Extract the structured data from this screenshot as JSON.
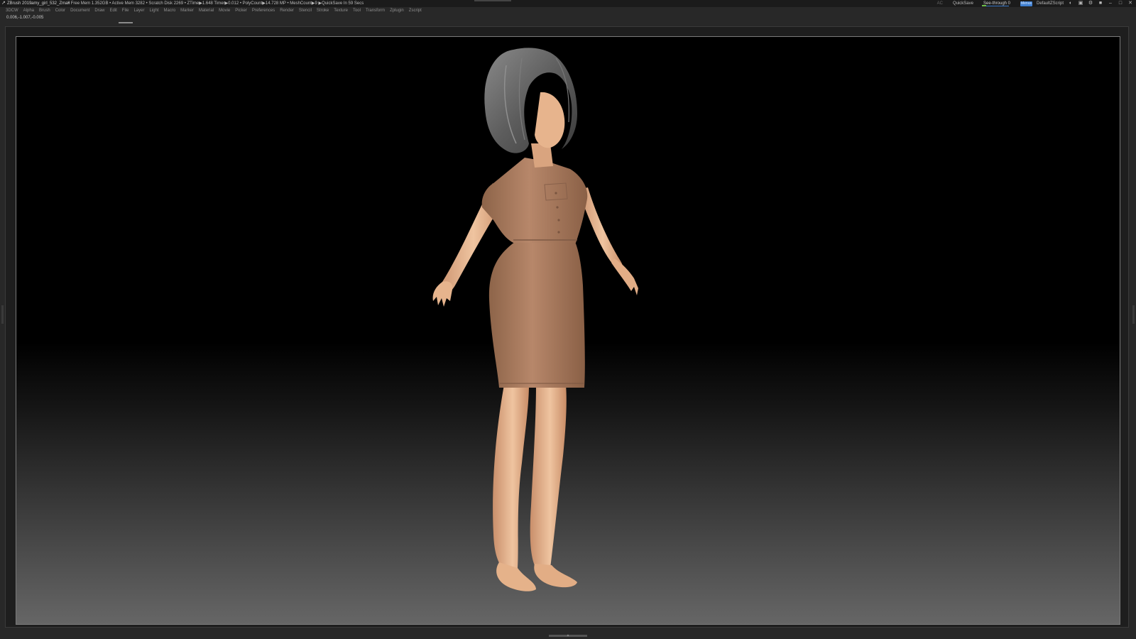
{
  "titlebar": {
    "app_name": "ZBrush 2019",
    "file_name": "amy_girl_532_Zmall",
    "status_text": "• Free Mem 1.352GB • Active Mem 3282 • Scratch Disk 2269 • ZTime▶1.648 Timer▶0.012 • PolyCount▶14.728 MP • MeshCount▶9 ▶QuickSave In 59 Secs",
    "ac_label": "AC",
    "quicksave_label": "QuickSave",
    "seethrough_label": "See-through 0",
    "menus_label": "Menus",
    "default_script_label": "DefaultZScript"
  },
  "menu": {
    "items": [
      "3DCW",
      "Alpha",
      "Brush",
      "Color",
      "Document",
      "Draw",
      "Edit",
      "File",
      "Layer",
      "Light",
      "Macro",
      "Marker",
      "Material",
      "Movie",
      "Picker",
      "Preferences",
      "Render",
      "Stencil",
      "Stroke",
      "Texture",
      "Tool",
      "Transform",
      "Zplugin",
      "Zscript"
    ]
  },
  "info": {
    "coords": "0.006,-1.007,-0.005"
  },
  "icons": {
    "logo": "zbrush-logo-icon",
    "window_controls": [
      "palette-icon",
      "layout-icon",
      "settings-icon",
      "lock-icon",
      "minimize-icon",
      "restore-icon",
      "close-icon"
    ]
  },
  "colors": {
    "accent": "#3f7fd0",
    "slider_fill": "#6fbf4a",
    "skin": "#e9b98f",
    "dress": "#a97a5d",
    "hair": "#6f6f6f"
  }
}
